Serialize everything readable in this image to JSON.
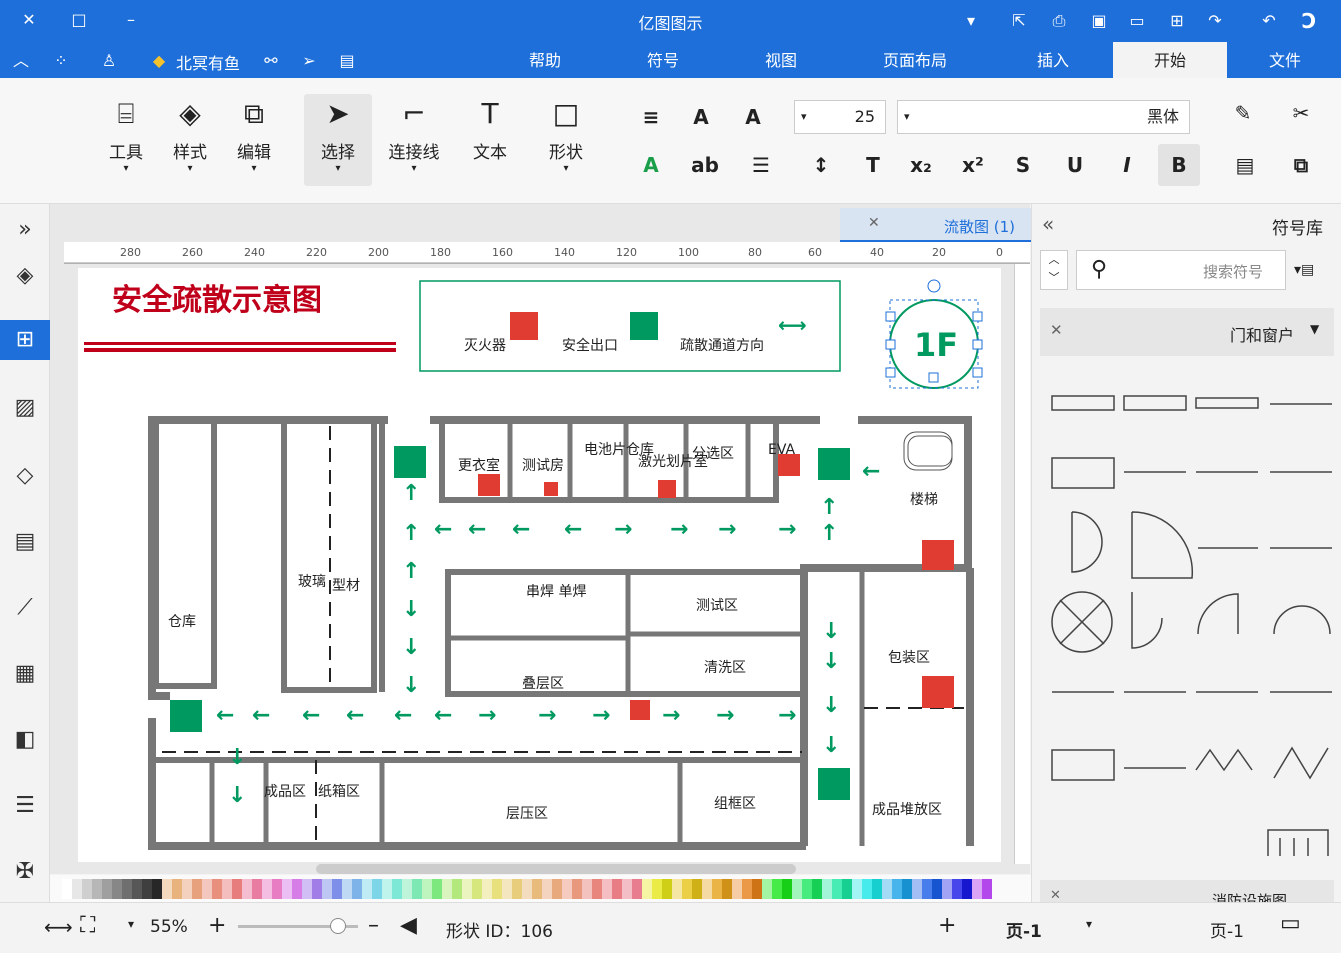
{
  "app": {
    "title": "亿图图示"
  },
  "menu": {
    "file": "文件",
    "start": "开始",
    "insert": "插入",
    "layout": "页面布局",
    "view": "视图",
    "symbol": "符号",
    "help": "帮助",
    "user": "北冥有鱼"
  },
  "ribbon": {
    "tools": "工具",
    "style": "样式",
    "edit": "编辑",
    "select": "选择",
    "connector": "连接线",
    "text": "文本",
    "shape": "形状",
    "font_family": "黑体",
    "font_size": "25"
  },
  "doc": {
    "tab_title": "流散图 (1)"
  },
  "floorplan": {
    "title": "安全疏散示意图",
    "legend": {
      "extinguisher": "灭火器",
      "exit": "安全出口",
      "direction": "疏散通道方向"
    },
    "floor_label": "1F",
    "rooms": {
      "warehouse": "仓库",
      "warehouse2": "仓\n库",
      "glass": "玻璃",
      "profile": "型材",
      "locker": "更衣室",
      "test": "测试房",
      "battery": "电池片仓库",
      "laser": "激光划片室",
      "sort": "分选区",
      "eva": "EVA",
      "stairs": "楼梯",
      "string": "串焊 单焊",
      "testarea": "测试区",
      "clean": "清洗区",
      "lamination": "叠层区",
      "packing": "包装区",
      "finished": "成品区",
      "carton": "纸箱区",
      "laminate": "层压区",
      "frame": "组框区",
      "finished_storage": "成品堆放区"
    }
  },
  "right": {
    "title": "符号库",
    "search_placeholder": "搜索符号",
    "category": "门和窗户",
    "bottom_category": "消防设施图"
  },
  "status": {
    "page_left": "页-1",
    "page_tab": "页-1",
    "shape_id": "形状 ID：106",
    "zoom": "55%"
  },
  "colors": {
    "brand": "#1e6fd9",
    "exit_green": "#009960",
    "fire_red": "#e03c31",
    "title_red": "#c0001a"
  }
}
